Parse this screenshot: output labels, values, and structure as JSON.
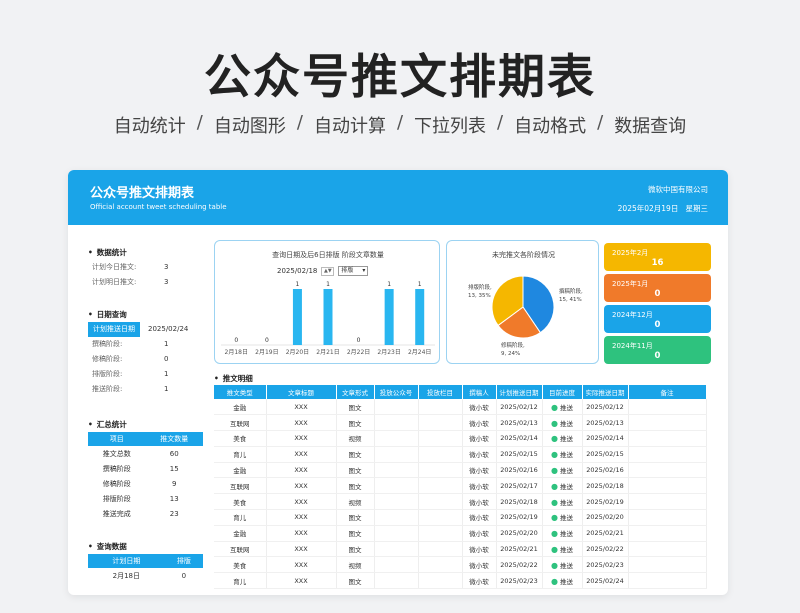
{
  "hero": {
    "title": "公众号推文排期表",
    "features": [
      "自动统计",
      "自动图形",
      "自动计算",
      "下拉列表",
      "自动格式",
      "数据查询"
    ]
  },
  "banner": {
    "title": "公众号推文排期表",
    "subtitle": "Official account tweet scheduling table",
    "company": "微软中国有限公司",
    "date": "2025年02月19日",
    "weekday": "星期三"
  },
  "sidebar": {
    "stats": {
      "heading": "数据统计",
      "rows": [
        {
          "k": "计划今日推文:",
          "v": "3"
        },
        {
          "k": "计划明日推文:",
          "v": "3"
        }
      ]
    },
    "date_query": {
      "heading": "日期查询",
      "label": "计划推送日期",
      "value": "2025/02/24",
      "rows": [
        {
          "k": "撰稿阶段:",
          "v": "1"
        },
        {
          "k": "修稿阶段:",
          "v": "0"
        },
        {
          "k": "排版阶段:",
          "v": "1"
        },
        {
          "k": "推送阶段:",
          "v": "1"
        }
      ]
    },
    "summary": {
      "heading": "汇总统计",
      "headers": [
        "项目",
        "推文数量"
      ],
      "rows": [
        [
          "推文总数",
          "60"
        ],
        [
          "撰稿阶段",
          "15"
        ],
        [
          "修稿阶段",
          "9"
        ],
        [
          "排版阶段",
          "13"
        ],
        [
          "推送完成",
          "23"
        ]
      ]
    },
    "query": {
      "heading": "查询数据",
      "headers": [
        "计划日期",
        "排版"
      ],
      "rows": [
        [
          "2月18日",
          "0"
        ]
      ]
    }
  },
  "bar_chart": {
    "title": "查询日期及后6日排版 阶段文章数量",
    "date": "2025/02/18",
    "select": "排版"
  },
  "pie_chart": {
    "title": "未完推文各阶段情况"
  },
  "tiles": [
    {
      "label": "2025年2月",
      "value": "16",
      "color": "#f5b700"
    },
    {
      "label": "2025年1月",
      "value": "0",
      "color": "#f07a2a"
    },
    {
      "label": "2024年12月",
      "value": "0",
      "color": "#1aa4e8"
    },
    {
      "label": "2024年11月",
      "value": "0",
      "color": "#2ec27e"
    }
  ],
  "detail": {
    "heading": "推文明细",
    "headers": [
      "推文类型",
      "文章标题",
      "文章形式",
      "投放公众号",
      "投放栏目",
      "撰稿人",
      "计划推送日期",
      "目前进度",
      "实际推送日期",
      "备注"
    ],
    "rows": [
      [
        "金融",
        "XXX",
        "图文",
        "",
        "",
        "微小软",
        "2025/02/12",
        "推送",
        "2025/02/12",
        ""
      ],
      [
        "互联网",
        "XXX",
        "图文",
        "",
        "",
        "微小软",
        "2025/02/13",
        "推送",
        "2025/02/13",
        ""
      ],
      [
        "美食",
        "XXX",
        "视频",
        "",
        "",
        "微小软",
        "2025/02/14",
        "推送",
        "2025/02/14",
        ""
      ],
      [
        "育儿",
        "XXX",
        "图文",
        "",
        "",
        "微小软",
        "2025/02/15",
        "推送",
        "2025/02/15",
        ""
      ],
      [
        "金融",
        "XXX",
        "图文",
        "",
        "",
        "微小软",
        "2025/02/16",
        "推送",
        "2025/02/16",
        ""
      ],
      [
        "互联网",
        "XXX",
        "图文",
        "",
        "",
        "微小软",
        "2025/02/17",
        "推送",
        "2025/02/18",
        ""
      ],
      [
        "美食",
        "XXX",
        "视频",
        "",
        "",
        "微小软",
        "2025/02/18",
        "推送",
        "2025/02/19",
        ""
      ],
      [
        "育儿",
        "XXX",
        "图文",
        "",
        "",
        "微小软",
        "2025/02/19",
        "推送",
        "2025/02/20",
        ""
      ],
      [
        "金融",
        "XXX",
        "图文",
        "",
        "",
        "微小软",
        "2025/02/20",
        "推送",
        "2025/02/21",
        ""
      ],
      [
        "互联网",
        "XXX",
        "图文",
        "",
        "",
        "微小软",
        "2025/02/21",
        "推送",
        "2025/02/22",
        ""
      ],
      [
        "美食",
        "XXX",
        "视频",
        "",
        "",
        "微小软",
        "2025/02/22",
        "推送",
        "2025/02/23",
        ""
      ],
      [
        "育儿",
        "XXX",
        "图文",
        "",
        "",
        "微小软",
        "2025/02/23",
        "推送",
        "2025/02/24",
        ""
      ]
    ]
  },
  "chart_data": [
    {
      "type": "bar",
      "title": "查询日期及后6日排版 阶段文章数量",
      "categories": [
        "2月18日",
        "2月19日",
        "2月20日",
        "2月21日",
        "2月22日",
        "2月23日",
        "2月24日"
      ],
      "values": [
        0,
        0,
        1,
        1,
        0,
        1,
        1
      ],
      "ylim": [
        0,
        1
      ],
      "color": "#29b6f0"
    },
    {
      "type": "pie",
      "title": "未完推文各阶段情况",
      "slices": [
        {
          "label": "撰稿阶段",
          "value": 15,
          "percent": "41%",
          "color": "#1f88e0"
        },
        {
          "label": "修稿阶段",
          "value": 9,
          "percent": "24%",
          "color": "#f07a2a"
        },
        {
          "label": "排版阶段",
          "value": 13,
          "percent": "35%",
          "color": "#f5b700"
        }
      ]
    }
  ]
}
